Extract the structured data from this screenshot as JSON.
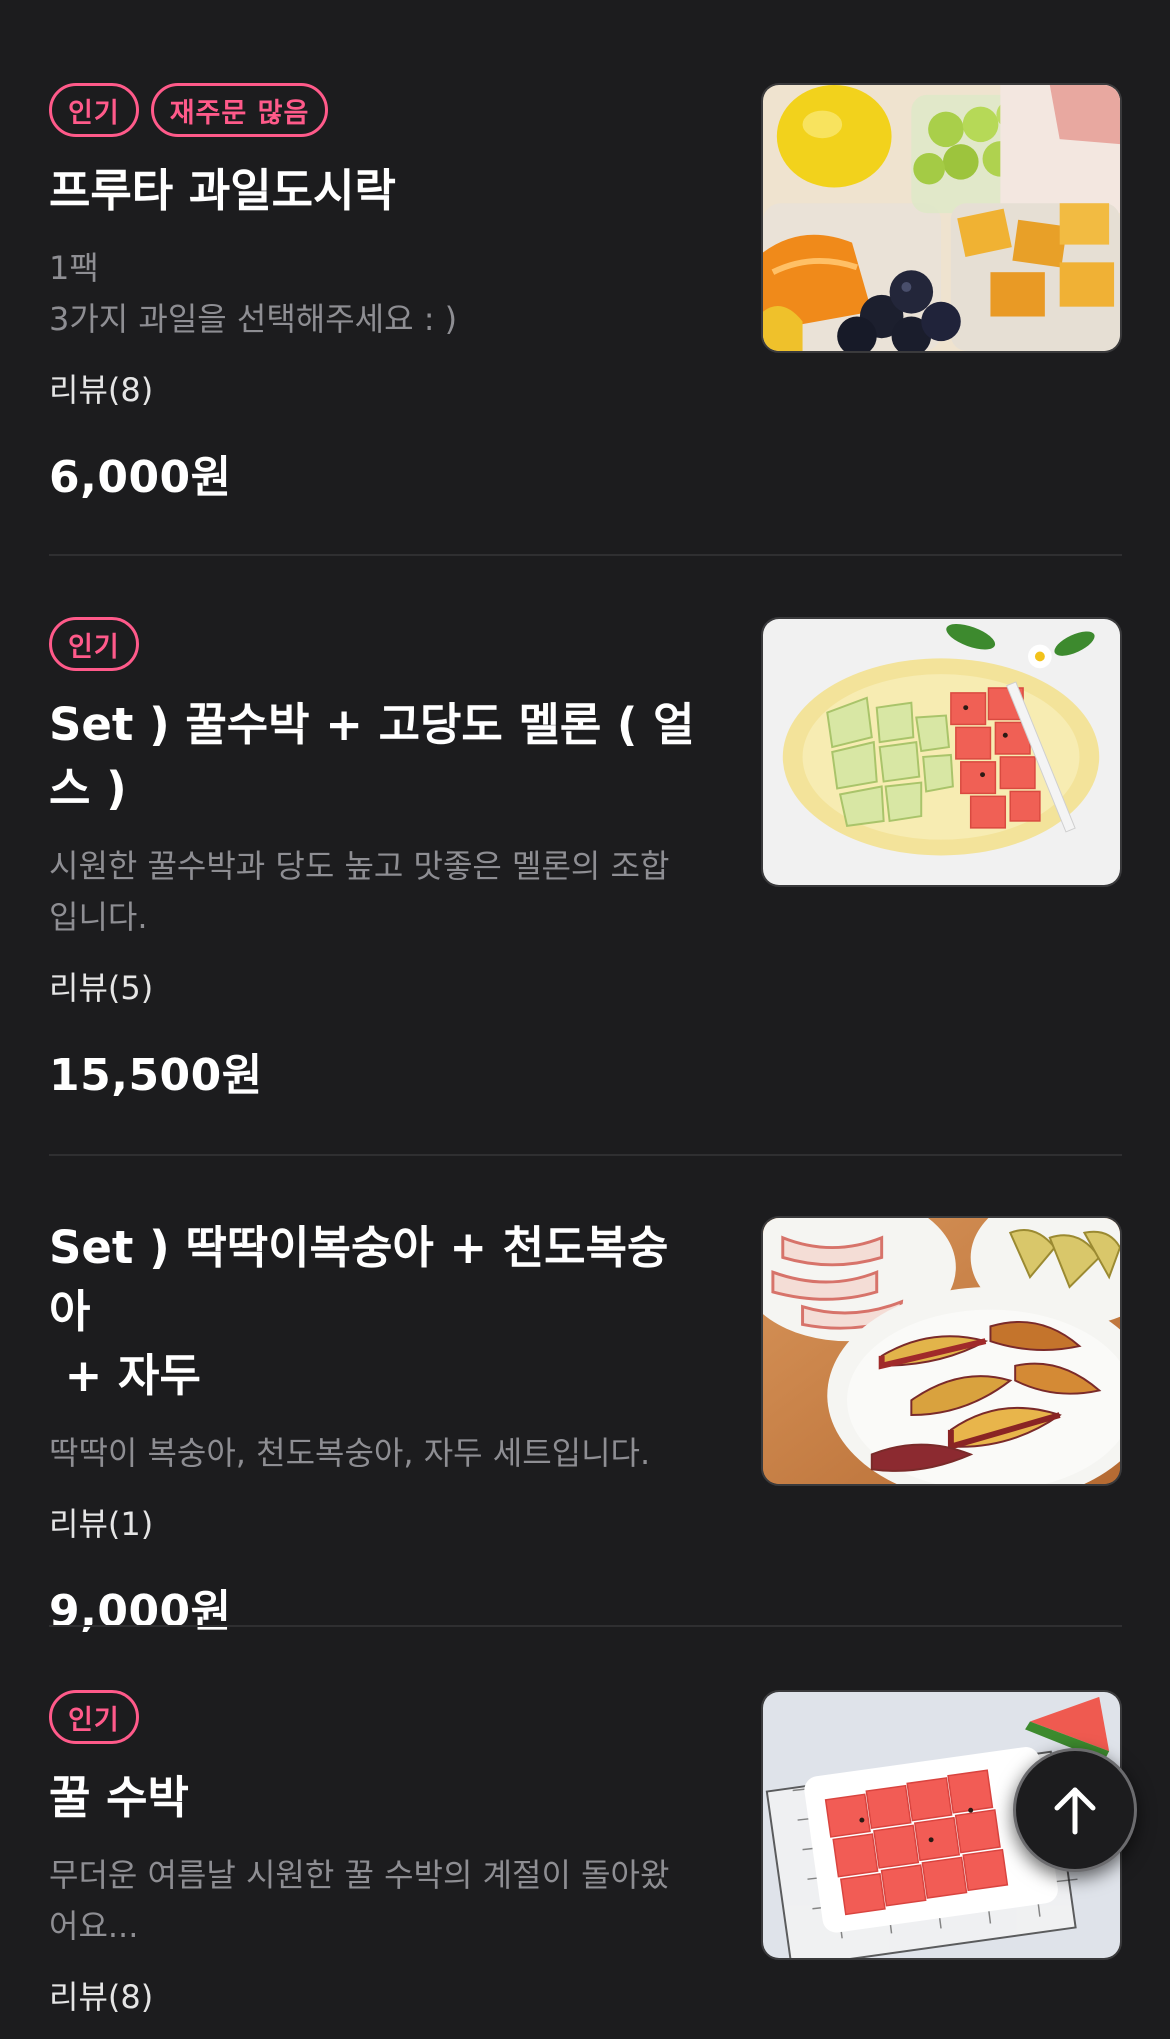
{
  "items": [
    {
      "badges": [
        "인기",
        "재주문 많음"
      ],
      "title_lines": [
        "프루타 과일도시락"
      ],
      "desc_lines": [
        "1팩",
        "3가지 과일을 선택해주세요 : )"
      ],
      "reviews": "리뷰(8)",
      "price": "6,000원",
      "image": "fruit-lunchbox-photo"
    },
    {
      "badges": [
        "인기"
      ],
      "title_lines": [
        "Set ) 꿀수박 + 고당도 멜론 ( 얼",
        "스 )"
      ],
      "desc_lines": [
        "시원한 꿀수박과 당도 높고 맛좋은 멜론의 조합",
        "입니다."
      ],
      "reviews": "리뷰(5)",
      "price": "15,500원",
      "image": "watermelon-melon-plate-photo"
    },
    {
      "badges": [],
      "title_lines": [
        "Set ) 딱딱이복숭아 + 천도복숭아",
        " + 자두"
      ],
      "desc_lines": [
        "딱딱이 복숭아, 천도복숭아, 자두 세트입니다."
      ],
      "reviews": "리뷰(1)",
      "price": "9,000원",
      "image": "peach-plum-plates-photo"
    },
    {
      "badges": [
        "인기"
      ],
      "title_lines": [
        "꿀 수박"
      ],
      "desc_lines": [
        "무더운 여름날 시원한 꿀 수박의 계절이 돌아왔",
        "어요..."
      ],
      "reviews": "리뷰(8)",
      "image": "watermelon-cubes-photo"
    }
  ],
  "scroll_top_icon": "arrow-up-icon",
  "colors": {
    "background": "#1c1c1e",
    "badge": "#ff5a8a",
    "muted_text": "#8e8e93"
  }
}
